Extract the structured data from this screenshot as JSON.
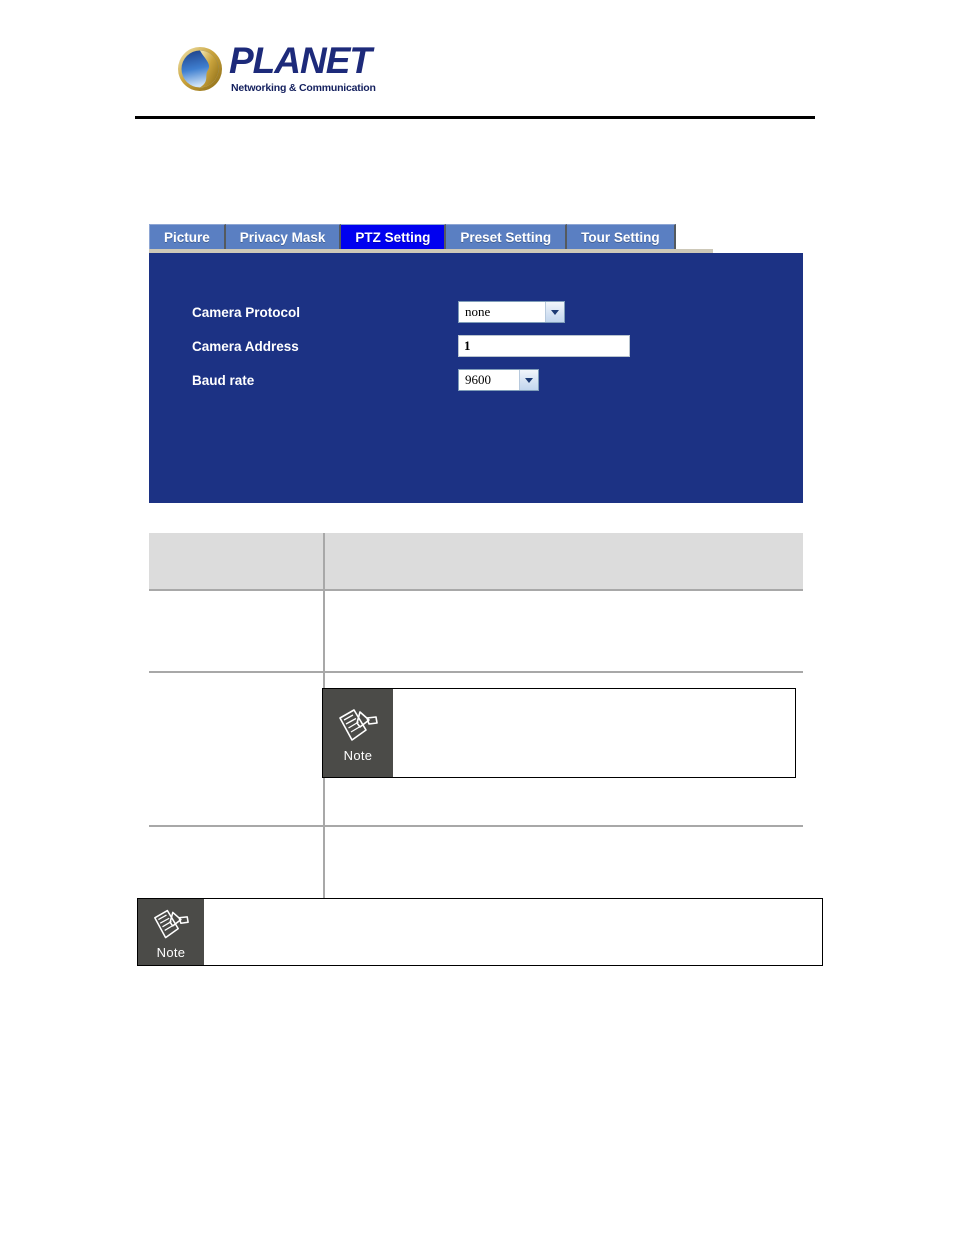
{
  "header": {
    "logo_name": "PLANET",
    "logo_tagline": "Networking & Communication",
    "logo_icon": "planet-globe-logo"
  },
  "tabs": [
    {
      "label": "Picture",
      "active": false,
      "name": "tab-picture"
    },
    {
      "label": "Privacy Mask",
      "active": false,
      "name": "tab-privacy-mask"
    },
    {
      "label": "PTZ Setting",
      "active": true,
      "name": "tab-ptz-setting"
    },
    {
      "label": "Preset Setting",
      "active": false,
      "name": "tab-preset-setting"
    },
    {
      "label": "Tour Setting",
      "active": false,
      "name": "tab-tour-setting"
    }
  ],
  "settings_panel": {
    "background_color": "#1c3284",
    "fields": [
      {
        "label": "Camera Protocol",
        "type": "select",
        "value": "none",
        "name": "camera-protocol"
      },
      {
        "label": "Camera Address",
        "type": "text",
        "value": "1",
        "placeholder": "",
        "name": "camera-address"
      },
      {
        "label": "Baud rate",
        "type": "select",
        "value": "9600",
        "name": "baud-rate"
      }
    ]
  },
  "description_table": {
    "header": {
      "col_left": "",
      "col_right": ""
    },
    "rows": [
      {
        "col_left": "",
        "col_right": ""
      },
      {
        "col_left": "",
        "col_right": ""
      },
      {
        "col_left": "",
        "col_right": ""
      }
    ]
  },
  "notes": [
    {
      "label": "Note",
      "text": "",
      "icon": "note-pen-paper-icon",
      "name": "note-inline"
    },
    {
      "label": "Note",
      "text": "",
      "icon": "note-pen-paper-icon",
      "name": "note-bottom"
    }
  ],
  "colors": {
    "panel_blue": "#1c3284",
    "tab_blue": "#5a7fc2",
    "tab_active_blue": "#0000f0",
    "table_header_gray": "#dcdcdc",
    "note_gray": "#4b4b48",
    "logo_navy": "#1d2a7a"
  }
}
